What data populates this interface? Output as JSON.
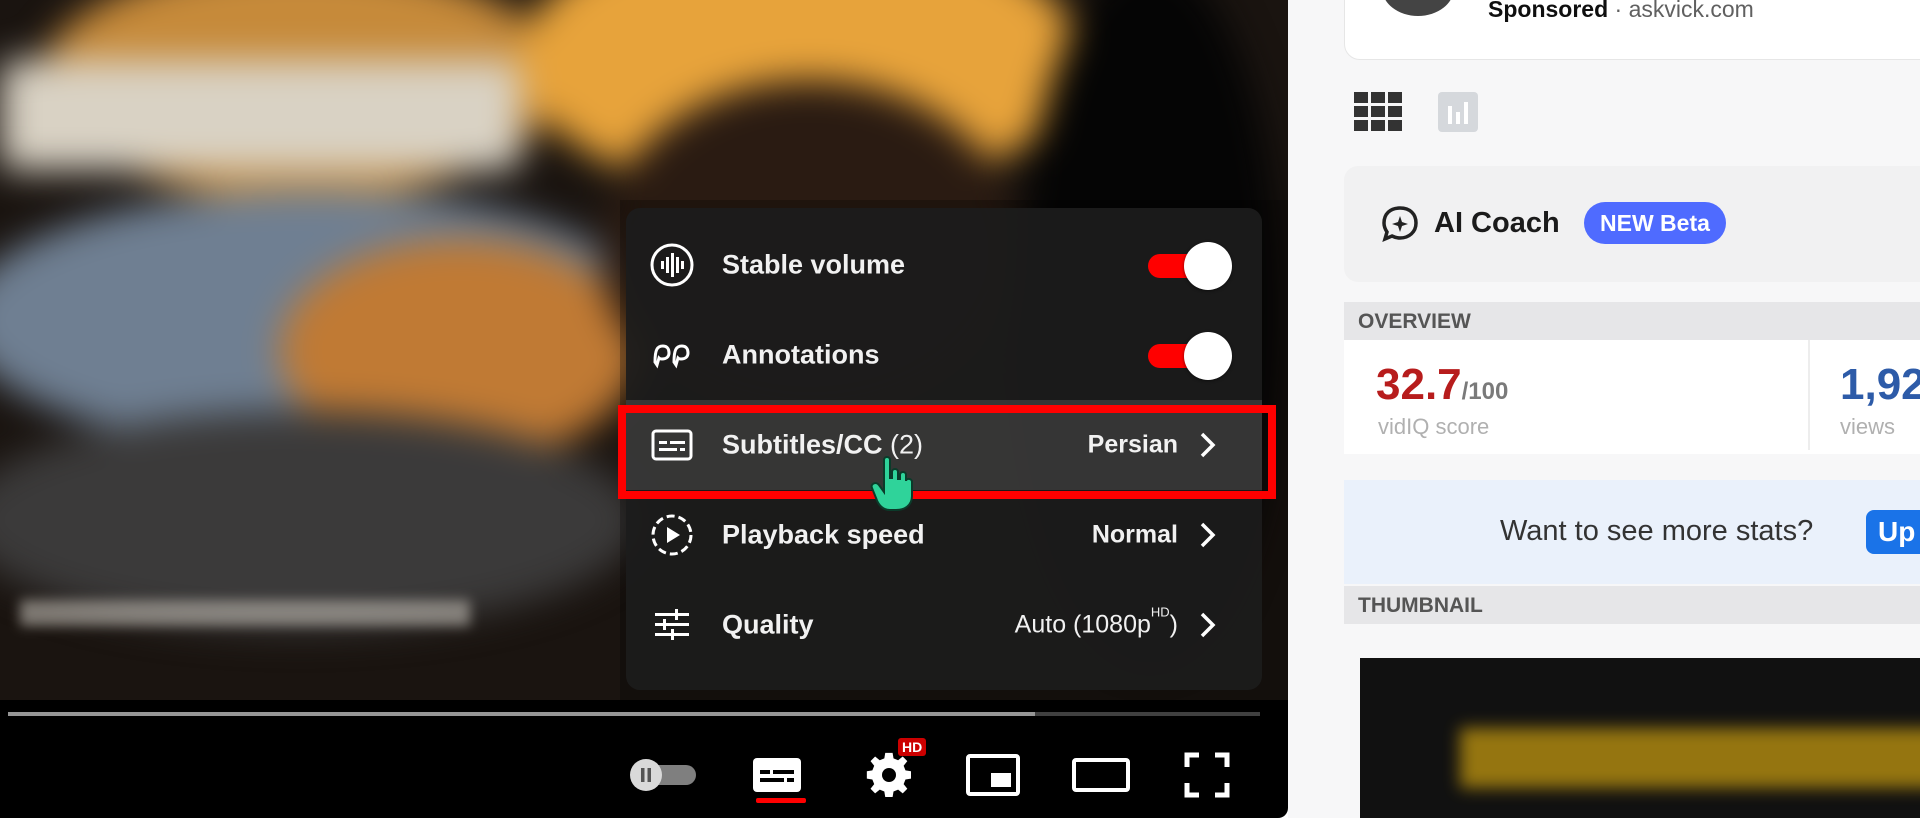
{
  "player": {
    "progress": {
      "buffered_fraction": 0.82
    },
    "settings_menu": {
      "items": [
        {
          "icon": "stable-volume-icon",
          "label": "Stable volume",
          "toggle_on": true
        },
        {
          "icon": "annotations-icon",
          "label": "Annotations",
          "toggle_on": true
        },
        {
          "icon": "subtitles-icon",
          "label": "Subtitles/CC",
          "count": "(2)",
          "value": "Persian",
          "highlighted": true
        },
        {
          "icon": "playback-speed-icon",
          "label": "Playback speed",
          "value": "Normal"
        },
        {
          "icon": "quality-icon",
          "label": "Quality",
          "value": "Auto (1080p",
          "value_sup": "HD",
          "value_close": ")"
        }
      ]
    },
    "controls": {
      "autoplay": "autoplay-toggle-icon",
      "subtitles": "subtitles-icon",
      "settings": "gear-icon",
      "settings_badge": "HD",
      "miniplayer": "miniplayer-icon",
      "theater": "theater-mode-icon",
      "fullscreen": "fullscreen-icon"
    },
    "annotation_color": "#ff0000"
  },
  "sidebar": {
    "sponsor": {
      "label": "Sponsored",
      "separator": "·",
      "domain": "askvick.com"
    },
    "tabs": [
      "grid-icon",
      "chart-icon"
    ],
    "ai_coach": {
      "title": "AI Coach",
      "badge": "NEW Beta",
      "badge_color": "#4f6bff"
    },
    "overview": {
      "header": "OVERVIEW",
      "score_value": "32.7",
      "score_denominator": "/100",
      "score_label": "vidIQ score",
      "views_value": "1,92",
      "views_label": "views"
    },
    "stats_banner": {
      "text": "Want to see more stats?",
      "button": "Up"
    },
    "thumbnail": {
      "header": "THUMBNAIL"
    }
  }
}
